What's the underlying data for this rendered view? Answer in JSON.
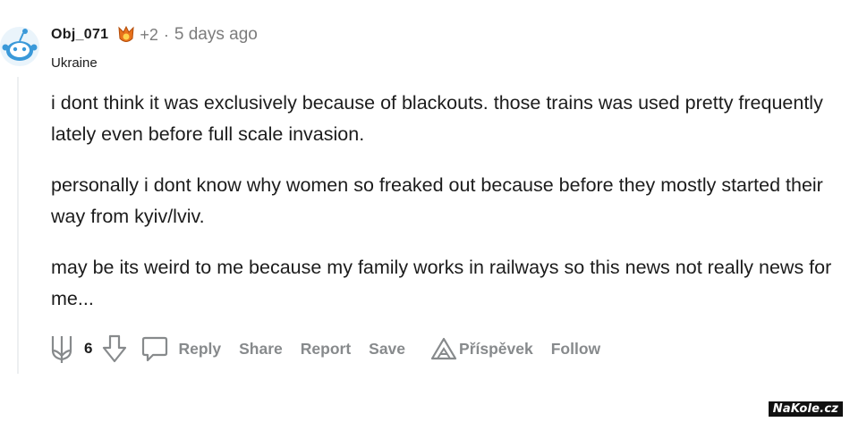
{
  "comment": {
    "username": "Obj_071",
    "award_count": "+2",
    "separator": "·",
    "timestamp": "5 days ago",
    "flair": "Ukraine",
    "paragraphs": [
      "i dont think it was exclusively because of blackouts. those trains was used pretty frequently lately even before full scale invasion.",
      "personally i dont know why women so freaked out because before they mostly started their way from kyiv/lviv.",
      "may be its weird to me because my family works in railways so this news not really news for me..."
    ],
    "score": "6",
    "actions": {
      "reply": "Reply",
      "share": "Share",
      "report": "Report",
      "save": "Save",
      "contribute": "Příspěvek",
      "follow": "Follow"
    }
  },
  "icons": {
    "avatar": "snoo-avatar-icon",
    "award": "award-icon",
    "upvote": "trident-upvote-icon",
    "downvote": "downvote-arrow-icon",
    "reply": "comment-bubble-icon",
    "contribute": "contribute-icon"
  },
  "colors": {
    "text": "#1c1c1c",
    "meta": "#7c7c7c",
    "action": "#878a8c",
    "avatar_blue": "#3a99d9",
    "award_orange": "#e8721c"
  },
  "watermark": "NaKole.cz"
}
